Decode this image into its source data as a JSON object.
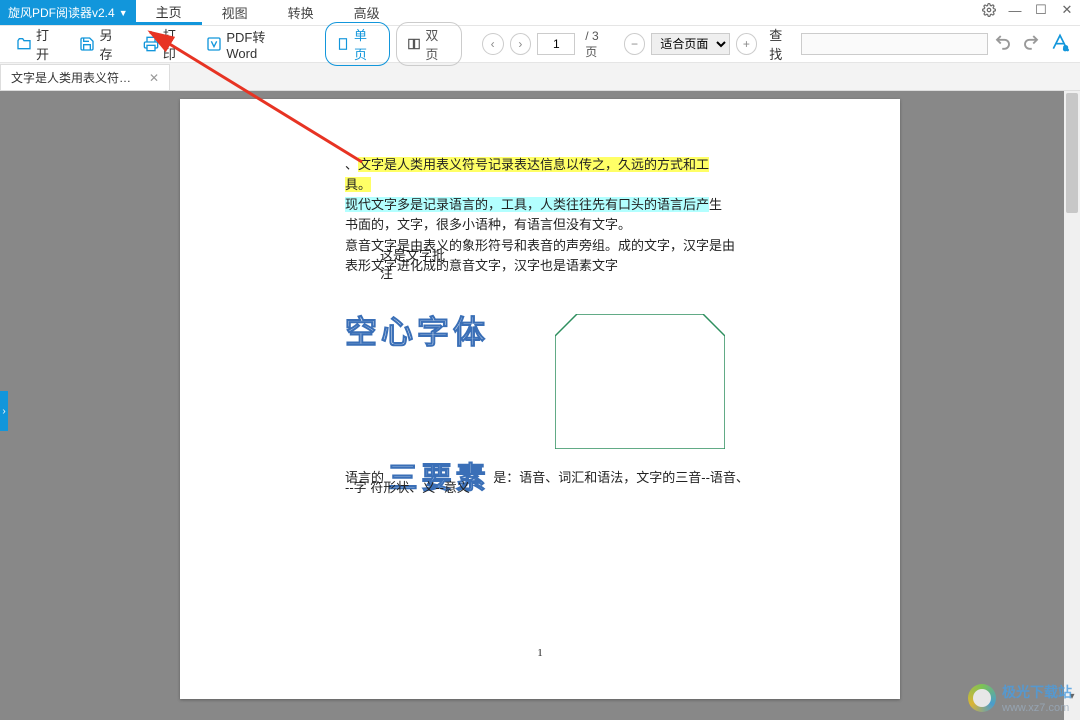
{
  "app": {
    "title": "旋风PDF阅读器v2.4"
  },
  "menu": {
    "items": [
      "主页",
      "视图",
      "转换",
      "高级"
    ],
    "active": 0
  },
  "toolbar": {
    "open": "打开",
    "saveas": "另存",
    "print": "打印",
    "pdf2word": "PDF转Word",
    "single": "单页",
    "double": "双页",
    "page_value": "1",
    "page_total": "/ 3 页",
    "zoom": "适合页面",
    "search_label": "查找"
  },
  "tabs": {
    "items": [
      {
        "label": "文字是人类用表义符号..."
      }
    ]
  },
  "doc": {
    "p1_seg1": "、",
    "p1_hl1": "文字是人类用表义符号记录表达信息以传之，久远的方式和工具。",
    "p1_seg2": "现代文字多是记录语言的，工具，人类往往先有口头的语言后产",
    "p1_seg3": "生书面的，文字，很多小语种，有语言但没有文字。",
    "p2": "意音文字是由表义的象形符号和表音的声旁组。成的文字，汉字是由表形文字进化成的意音文字，汉字也是语素文字",
    "note_l1": "这是文字批",
    "note_l2": "注",
    "art1": "空心字体",
    "art2": "三要素",
    "p3a": "语言的",
    "p3b": "是：语音、词汇和语法，文字的三音--语音、",
    "p4": "--字 符形状、义--意义",
    "pagenum": "1"
  },
  "watermark": {
    "name": "极光下载站",
    "url": "www.xz7.com"
  }
}
